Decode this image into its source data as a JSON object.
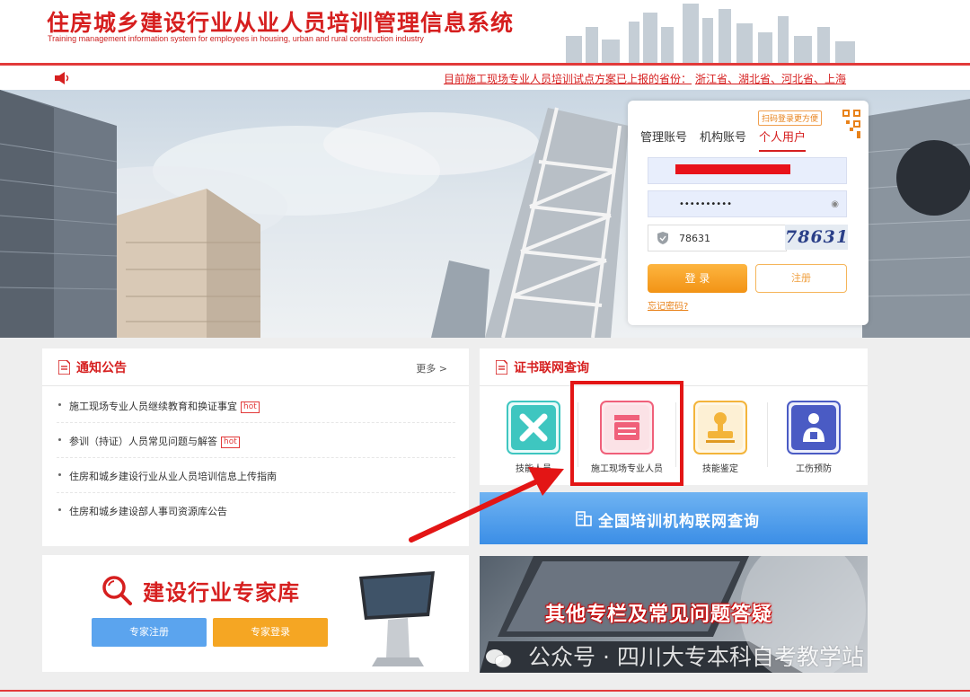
{
  "header": {
    "title": "住房城乡建设行业从业人员培训管理信息系统",
    "subtitle": "Training management information system for employees in housing, urban and rural construction industry"
  },
  "noticebar": {
    "text": "目前施工现场专业人员培训试点方案已上报的省份：",
    "provinces": "浙江省、湖北省、河北省、上海"
  },
  "login": {
    "qr_tip": "扫码登录更方便",
    "tabs": [
      "管理账号",
      "机构账号",
      "个人用户"
    ],
    "active_tab": "个人用户",
    "password_mask": "••••••••••",
    "captcha_value": "78631",
    "captcha_image_text": "78631",
    "login_label": "登 录",
    "register_label": "注册",
    "forgot_label": "忘记密码?"
  },
  "notice": {
    "title": "通知公告",
    "more": "更多 >",
    "items": [
      {
        "text": "施工现场专业人员继续教育和换证事宜",
        "hot": "hot"
      },
      {
        "text": "参训（持证）人员常见问题与解答",
        "hot": "hot"
      },
      {
        "text": "住房和城乡建设行业从业人员培训信息上传指南",
        "hot": ""
      },
      {
        "text": "住房和城乡建设部人事司资源库公告",
        "hot": ""
      }
    ]
  },
  "cert": {
    "title": "证书联网查询",
    "items": [
      {
        "label": "技能人员",
        "icon": "tools-icon",
        "color": "#3ec6c0"
      },
      {
        "label": "施工现场专业人员",
        "icon": "clapperboard-icon",
        "color": "#f0607a"
      },
      {
        "label": "技能鉴定",
        "icon": "stamp-icon",
        "color": "#f3b43a"
      },
      {
        "label": "工伤预防",
        "icon": "worker-icon",
        "color": "#4a5bc4"
      }
    ]
  },
  "national": {
    "label": "全国培训机构联网查询",
    "icon": "building-icon"
  },
  "expert": {
    "title": "建设行业专家库",
    "register_label": "专家注册",
    "login_label": "专家登录"
  },
  "faq": {
    "title": "其他专栏及常见问题答疑"
  },
  "watermark": {
    "text": "公众号 · 四川大专本科自考教学站"
  },
  "colors": {
    "brand_red": "#d61f1f",
    "accent_orange": "#f29315",
    "blue": "#3b8ee6",
    "highlight_box": "#e31515"
  }
}
